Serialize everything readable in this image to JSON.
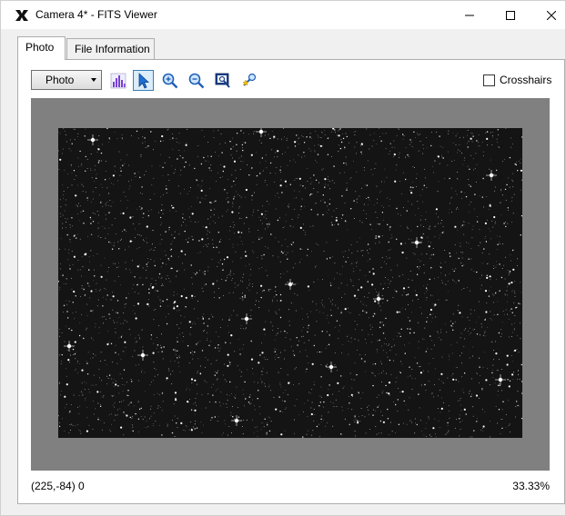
{
  "window": {
    "title": "Camera 4* - FITS Viewer",
    "icon": "x-logo-icon"
  },
  "tabs": [
    {
      "label": "Photo",
      "selected": true
    },
    {
      "label": "File Information",
      "selected": false
    }
  ],
  "toolbar": {
    "mode_select": {
      "value": "Photo"
    },
    "tools": [
      {
        "name": "histogram-icon",
        "active": false
      },
      {
        "name": "pointer-arrow-icon",
        "active": true
      },
      {
        "name": "zoom-in-icon",
        "active": false
      },
      {
        "name": "zoom-out-icon",
        "active": false
      },
      {
        "name": "zoom-fit-icon",
        "active": false
      },
      {
        "name": "star-locate-icon",
        "active": false
      }
    ],
    "crosshairs": {
      "label": "Crosshairs",
      "checked": false
    }
  },
  "status": {
    "coords": "(225,-84) 0",
    "zoom": "33.33%"
  },
  "colors": {
    "accent": "#3c7fb1",
    "viewport_bg": "#808080",
    "sky_bg": "#141414"
  }
}
